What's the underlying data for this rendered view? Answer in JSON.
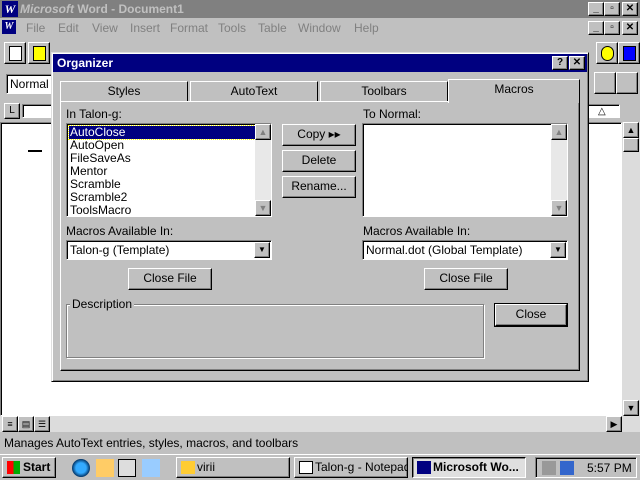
{
  "word": {
    "title_brand": "Microsoft",
    "title_rest": "Word - Document1",
    "menu": [
      "File",
      "Edit",
      "View",
      "Insert",
      "Format",
      "Tools",
      "Table",
      "Window",
      "Help"
    ],
    "style_value": "Normal",
    "status_text": "Manages AutoText entries, styles, macros, and toolbars"
  },
  "organizer": {
    "title": "Organizer",
    "tabs": [
      "Styles",
      "AutoText",
      "Toolbars",
      "Macros"
    ],
    "selected_tab": "Macros",
    "left": {
      "label": "In Talon-g:",
      "items": [
        "AutoClose",
        "AutoOpen",
        "FileSaveAs",
        "Mentor",
        "Scramble",
        "Scramble2",
        "ToolsMacro"
      ],
      "selected": "AutoClose",
      "available_label": "Macros Available In:",
      "available_value": "Talon-g (Template)",
      "close_file": "Close File"
    },
    "right": {
      "label": "To Normal:",
      "items": [],
      "available_label": "Macros Available In:",
      "available_value": "Normal.dot (Global Template)",
      "close_file": "Close File"
    },
    "buttons": {
      "copy": "Copy",
      "delete": "Delete",
      "rename": "Rename...",
      "close": "Close"
    },
    "description_label": "Description"
  },
  "taskbar": {
    "start": "Start",
    "tasks": [
      "virii",
      "Talon-g - Notepad",
      "Microsoft Wo..."
    ],
    "active_task": "Microsoft Wo...",
    "clock": "5:57 PM"
  },
  "colors": {
    "title_active": "#000080",
    "title_inactive": "#808080",
    "face": "#c0c0c0"
  }
}
